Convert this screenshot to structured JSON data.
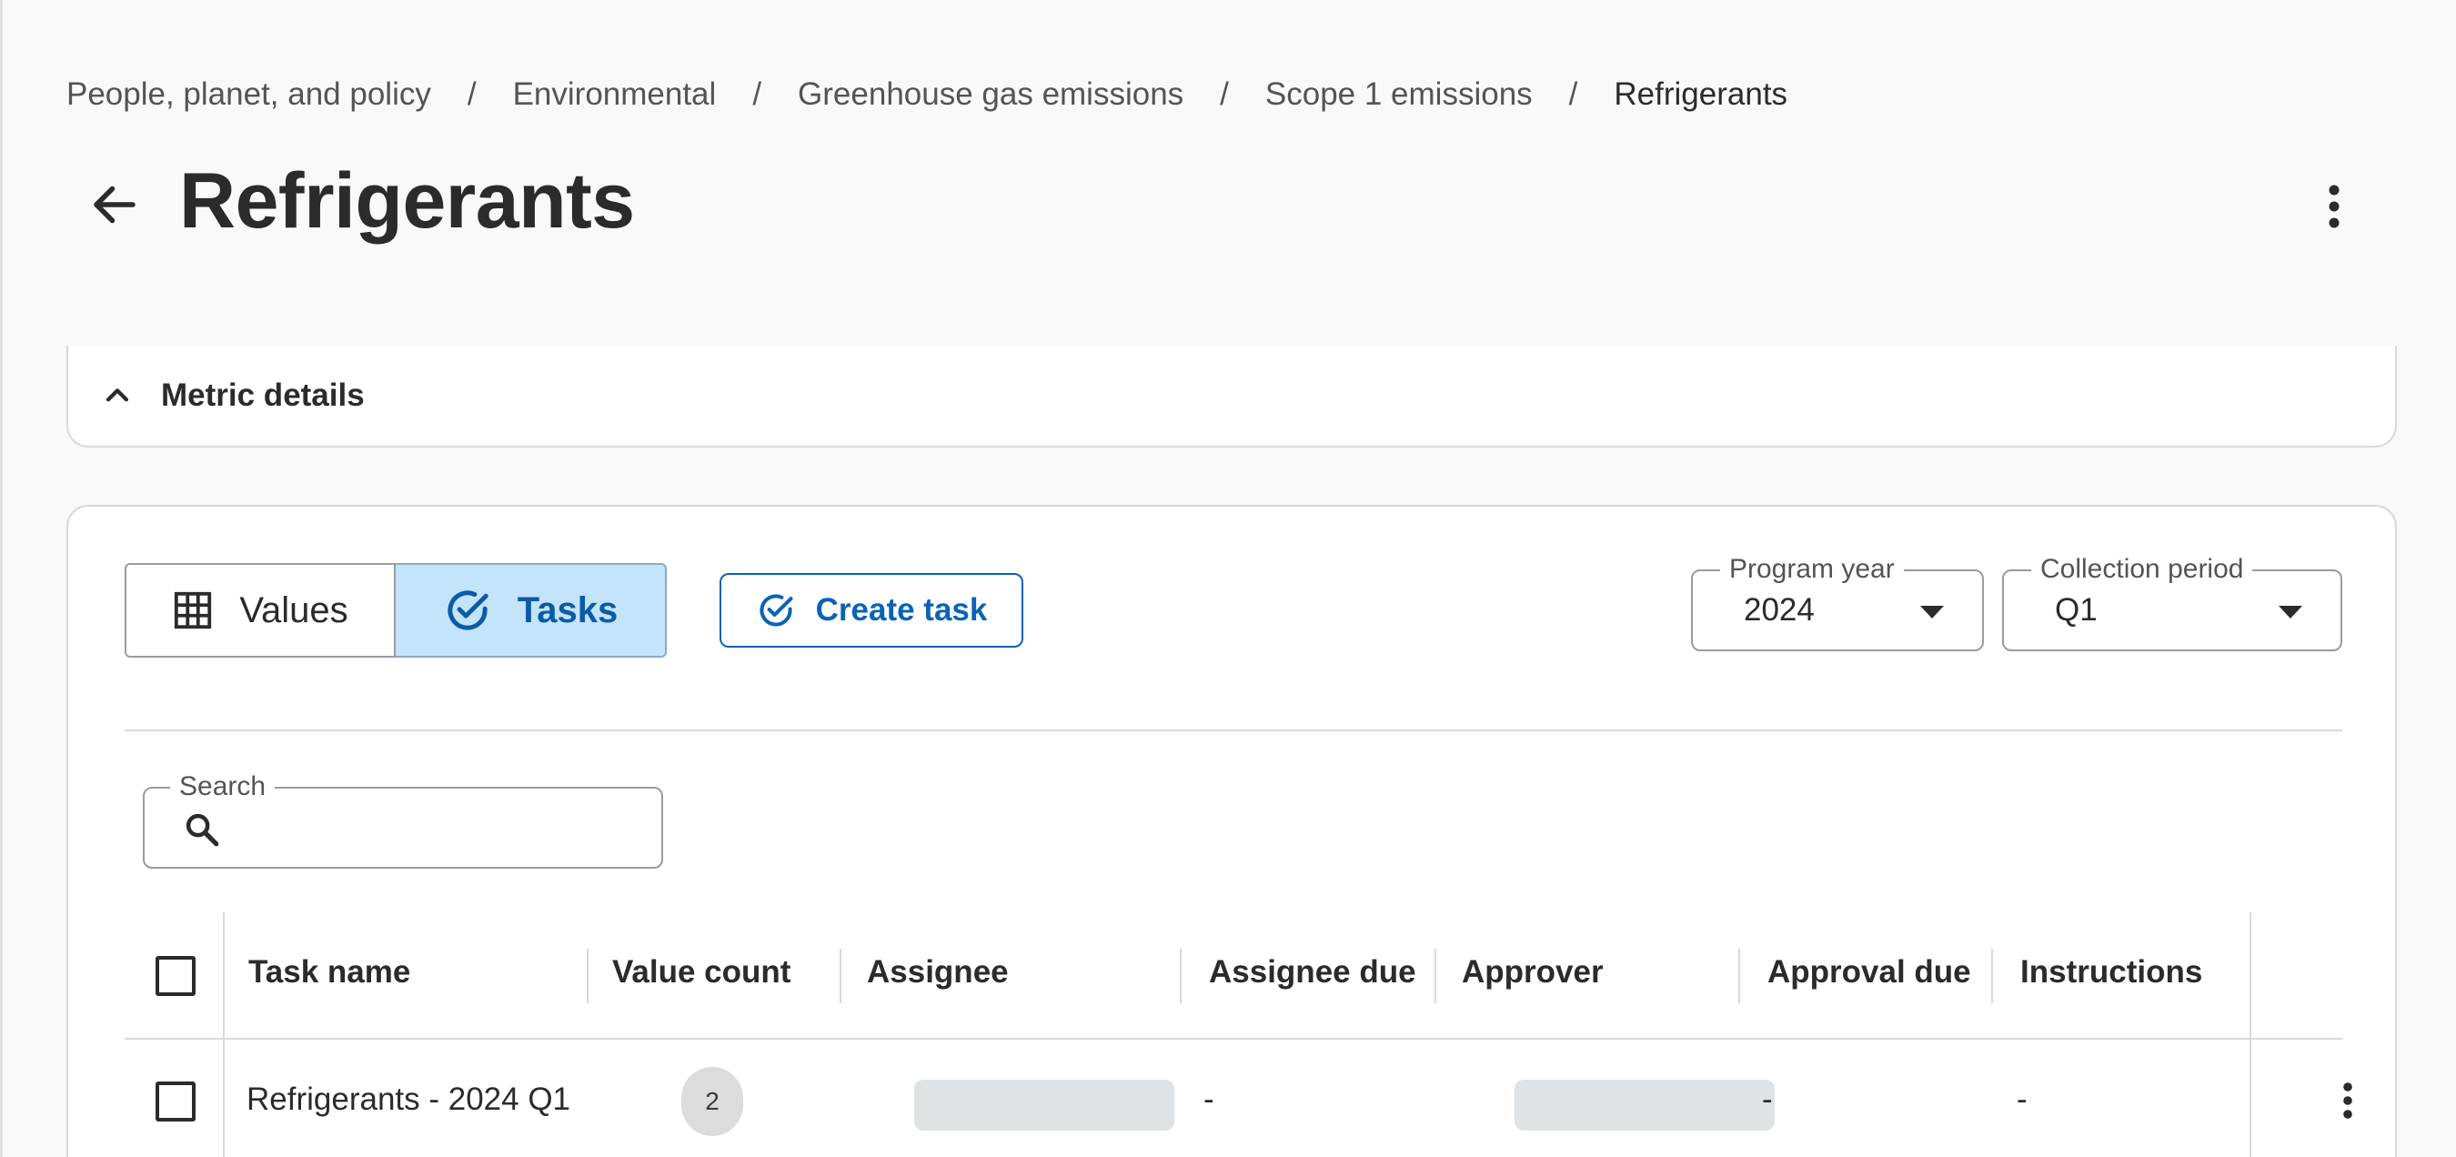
{
  "breadcrumb": {
    "items": [
      "People, planet, and policy",
      "Environmental",
      "Greenhouse gas emissions",
      "Scope 1 emissions",
      "Refrigerants"
    ],
    "separator": "/"
  },
  "header": {
    "title": "Refrigerants",
    "back_icon": "arrow-left-icon",
    "menu_icon": "more-vertical-icon"
  },
  "metric_details": {
    "label": "Metric details",
    "expanded": true
  },
  "view_toggle": {
    "values_label": "Values",
    "tasks_label": "Tasks",
    "selected": "Tasks"
  },
  "create_task": {
    "label": "Create task"
  },
  "filters": {
    "program_year": {
      "label": "Program year",
      "value": "2024"
    },
    "collection_period": {
      "label": "Collection period",
      "value": "Q1"
    }
  },
  "search": {
    "label": "Search",
    "value": ""
  },
  "table": {
    "columns": [
      "Task name",
      "Value count",
      "Assignee",
      "Assignee due",
      "Approver",
      "Approval due",
      "Instructions"
    ],
    "rows": [
      {
        "task_name": "Refrigerants - 2024 Q1",
        "value_count": "2",
        "assignee_due": "-",
        "approval_due": "-",
        "instructions": "-"
      }
    ]
  },
  "colors": {
    "accent": "#0a63b7",
    "selected_bg": "#c4e4fb",
    "skeleton": "#e0e3e6"
  }
}
